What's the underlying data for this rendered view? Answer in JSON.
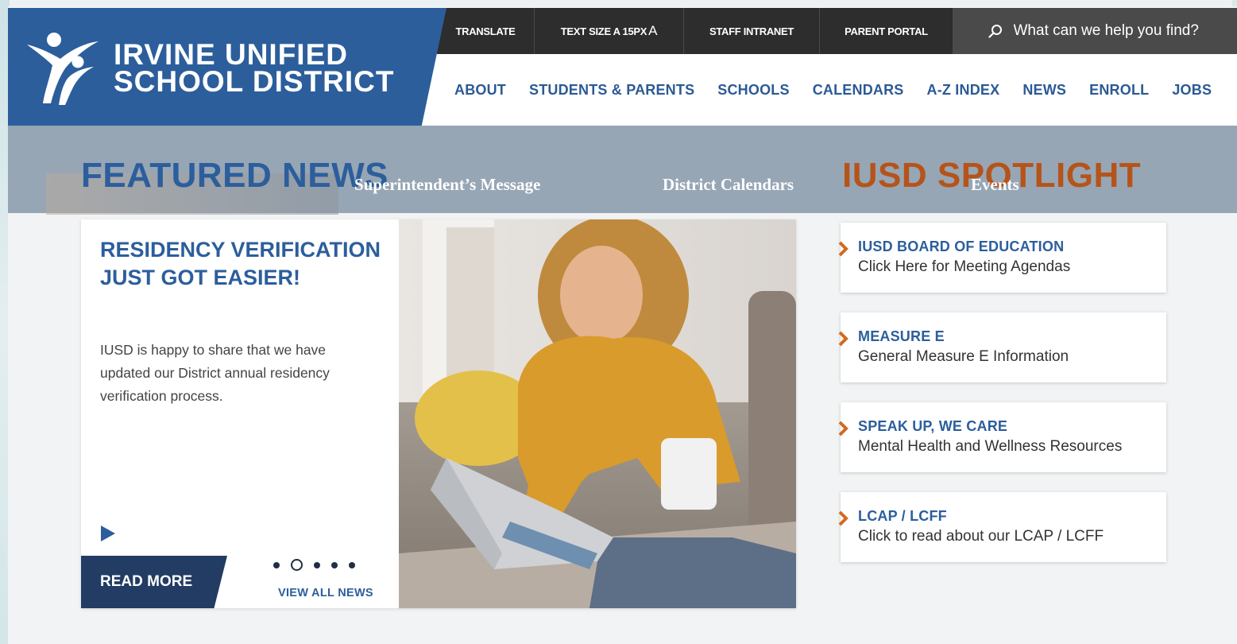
{
  "district": {
    "name_line1": "IRVINE UNIFIED",
    "name_line2": "SCHOOL DISTRICT",
    "brand_blue": "#2c5e9c",
    "accent_orange": "#b5541a"
  },
  "utility": {
    "translate": "TRANSLATE",
    "text_size": "TEXT SIZE A 15PX",
    "text_size_big": "A",
    "staff_intranet": "STAFF INTRANET",
    "parent_portal": "PARENT PORTAL",
    "search_placeholder": "What can we help you find?",
    "search_icon": "search-icon"
  },
  "nav": {
    "items": [
      {
        "label": "ABOUT"
      },
      {
        "label": "STUDENTS & PARENTS"
      },
      {
        "label": "SCHOOLS"
      },
      {
        "label": "CALENDARS"
      },
      {
        "label": "A-Z INDEX"
      },
      {
        "label": "NEWS"
      },
      {
        "label": "ENROLL"
      },
      {
        "label": "JOBS"
      }
    ]
  },
  "band": {
    "featured_news": "FEATURED NEWS",
    "spotlight": "IUSD SPOTLIGHT",
    "tabs": [
      {
        "label": "Superintendent’s Message"
      },
      {
        "label": "District Calendars"
      },
      {
        "label": "Events"
      }
    ]
  },
  "feature": {
    "headline": "RESIDENCY VERIFICATION JUST GOT EASIER!",
    "body": "IUSD is happy to share that we have updated our District annual residency verification process.",
    "read_more": "READ MORE",
    "view_all": "VIEW ALL NEWS",
    "slide_count": 5,
    "active_slide": 2
  },
  "spotlight": {
    "items": [
      {
        "title": "IUSD BOARD OF EDUCATION",
        "subtitle": "Click Here for Meeting Agendas"
      },
      {
        "title": "MEASURE E",
        "subtitle": "General Measure E Information"
      },
      {
        "title": "SPEAK UP, WE CARE",
        "subtitle": "Mental Health and Wellness Resources"
      },
      {
        "title": "LCAP / LCFF",
        "subtitle": "Click to read about our LCAP / LCFF"
      }
    ]
  }
}
